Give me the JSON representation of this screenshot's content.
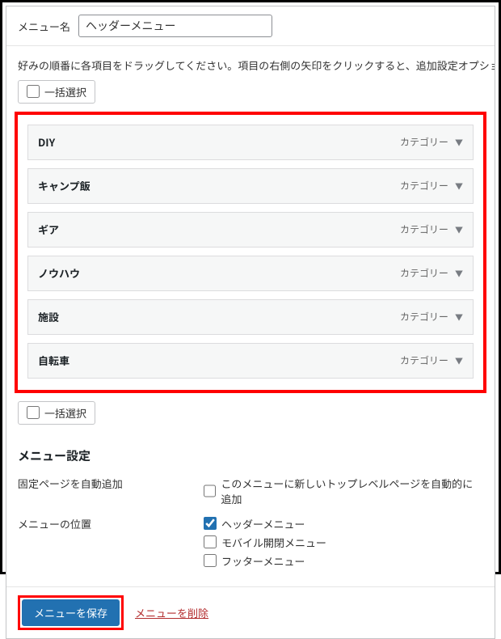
{
  "menu_name_label": "メニュー名",
  "menu_name_value": "ヘッダーメニュー",
  "instructions": "好みの順番に各項目をドラッグしてください。項目の右側の矢印をクリックすると、追加設定オプションを表",
  "bulk_select_label": "一括選択",
  "items": [
    {
      "title": "DIY",
      "type": "カテゴリー"
    },
    {
      "title": "キャンプ飯",
      "type": "カテゴリー"
    },
    {
      "title": "ギア",
      "type": "カテゴリー"
    },
    {
      "title": "ノウハウ",
      "type": "カテゴリー"
    },
    {
      "title": "施設",
      "type": "カテゴリー"
    },
    {
      "title": "自転車",
      "type": "カテゴリー"
    }
  ],
  "settings_heading": "メニュー設定",
  "auto_add_label": "固定ページを自動追加",
  "auto_add_text": "このメニューに新しいトップレベルページを自動的に追加",
  "location_label": "メニューの位置",
  "locations": [
    {
      "label": "ヘッダーメニュー",
      "checked": true
    },
    {
      "label": "モバイル開閉メニュー",
      "checked": false
    },
    {
      "label": "フッターメニュー",
      "checked": false
    }
  ],
  "save_button": "メニューを保存",
  "delete_link": "メニューを削除"
}
